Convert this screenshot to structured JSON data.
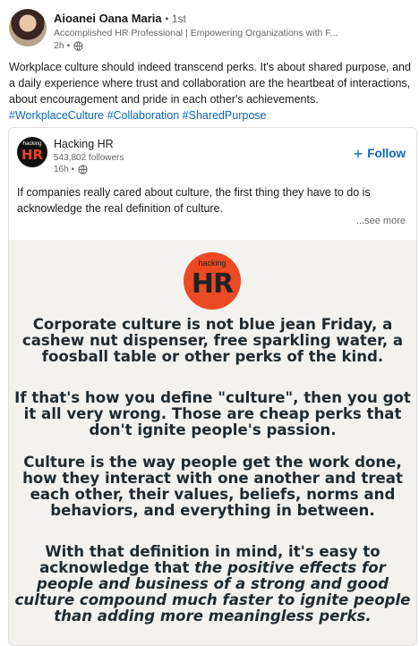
{
  "post": {
    "author_name": "Aioanei Oana Maria",
    "author_degree": "• 1st",
    "author_headline": "Accomplished HR Professional | Empowering Organizations with F...",
    "time": "2h •",
    "icon_globe": "globe-icon",
    "text_main": "Workplace culture should indeed transcend perks. It's about shared purpose, and a daily experience where trust and collaboration are the heartbeat of interactions, about encouragement and pride in each other's achievements. ",
    "hashtags": [
      "#WorkplaceCulture",
      "#Collaboration",
      "#SharedPurpose"
    ]
  },
  "shared": {
    "org_name": "Hacking HR",
    "logo_small": "hacking",
    "logo_big": "HR",
    "followers": "543,802 followers",
    "time": "16h •",
    "follow_label": "Follow",
    "follow_icon": "+",
    "text": "If companies really cared about culture, the first thing they have to do is acknowledge the real definition of culture.",
    "see_more": "...see more",
    "accent_color": "#0a66c2"
  },
  "image": {
    "logo_small": "hacking",
    "logo_big": "HR",
    "logo_color": "#ec4a23",
    "p1": "Corporate culture is not blue jean Friday, a cashew nut dispenser, free sparkling water, a foosball table or other perks of the kind.",
    "p2": "If that's how you define \"culture\", then you got it all very wrong. Those are cheap perks that don't ignite people's passion.",
    "p3": "Culture is the way people get the work done, how they interact with one another and treat each other, their values, beliefs, norms and behaviors, and everything in between.",
    "p4_plain": "With that definition in mind, it's easy to acknowledge that ",
    "p4_italic": "the positive effects for people and business of a strong and good culture compound much faster to ignite people than adding more meaningless perks."
  }
}
